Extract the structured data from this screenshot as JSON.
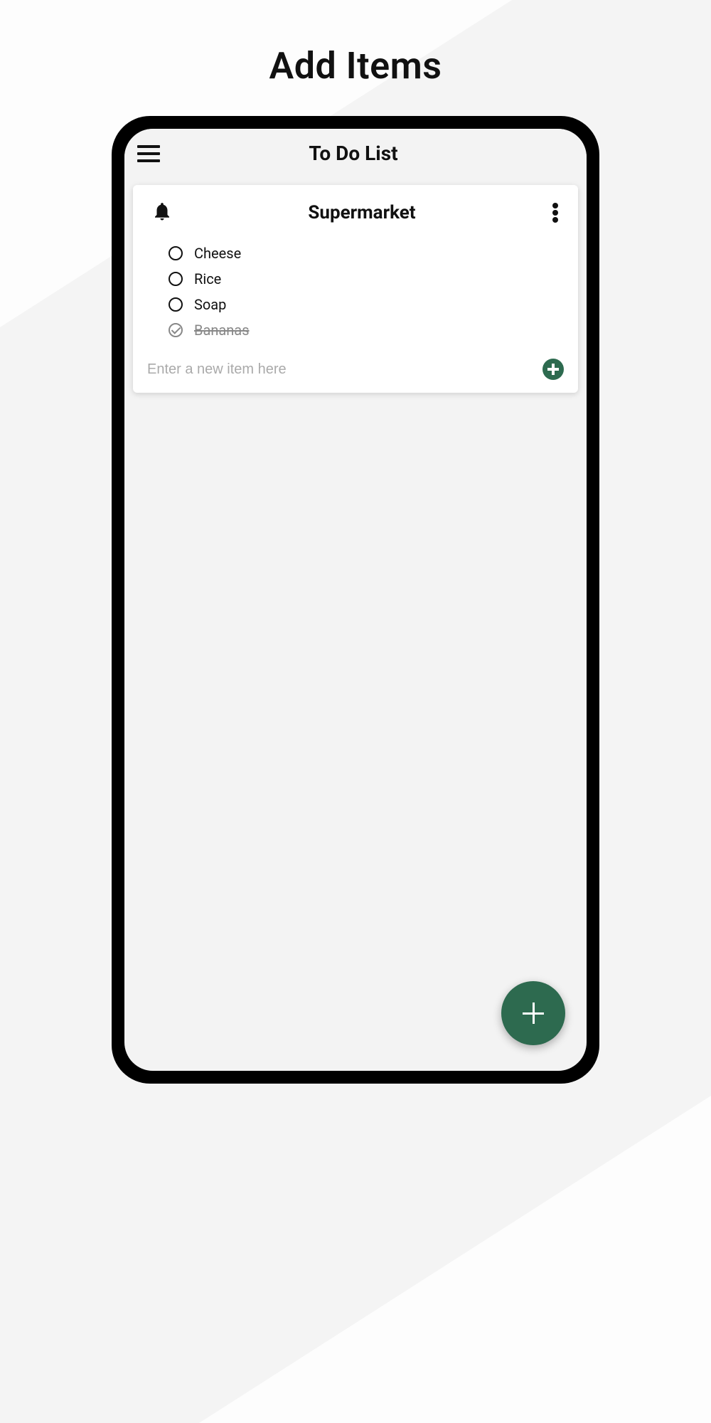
{
  "page": {
    "title": "Add Items"
  },
  "app": {
    "title": "To Do List"
  },
  "card": {
    "title": "Supermarket",
    "items": [
      {
        "label": "Cheese",
        "completed": false
      },
      {
        "label": "Rice",
        "completed": false
      },
      {
        "label": "Soap",
        "completed": false
      },
      {
        "label": "Bananas",
        "completed": true
      }
    ],
    "input_placeholder": "Enter a new item here"
  },
  "colors": {
    "accent": "#2d6a4f"
  }
}
